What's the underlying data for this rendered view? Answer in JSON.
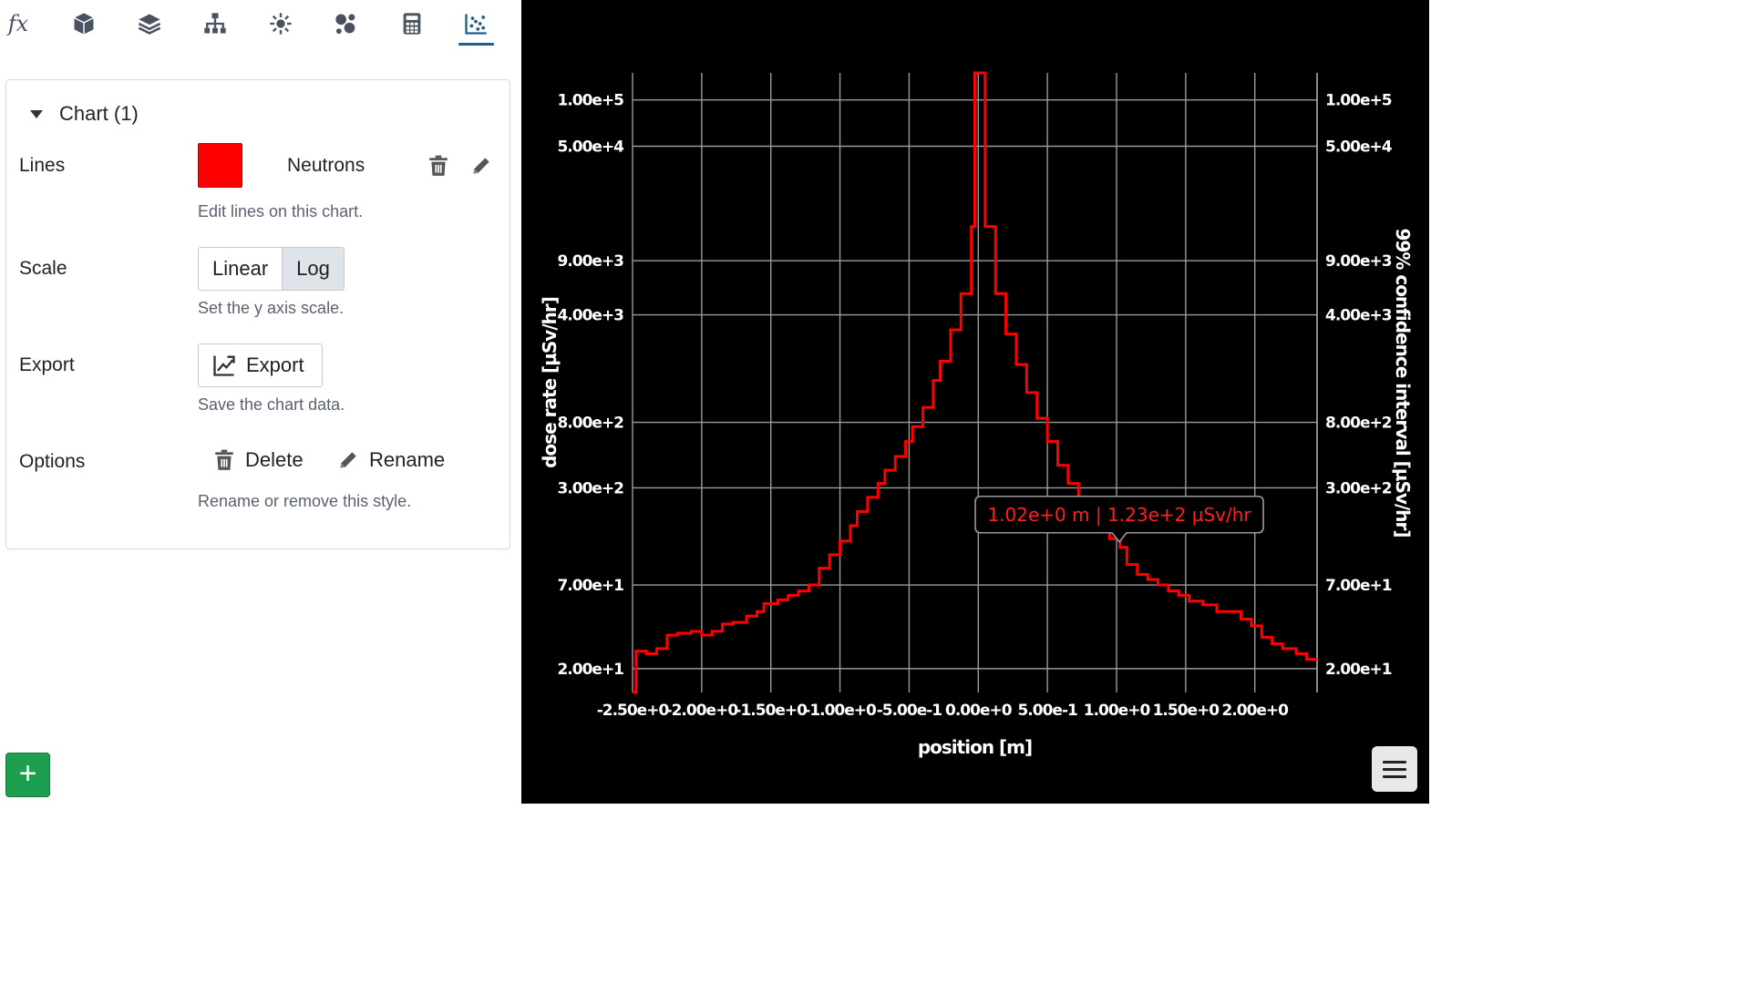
{
  "toolbar": {
    "items": [
      {
        "icon": "function-icon",
        "glyph": "fx"
      },
      {
        "icon": "cube-icon"
      },
      {
        "icon": "layers-icon"
      },
      {
        "icon": "hierarchy-icon"
      },
      {
        "icon": "radiation-source-icon"
      },
      {
        "icon": "molecule-icon"
      },
      {
        "icon": "calculator-icon"
      },
      {
        "icon": "scatter-chart-icon",
        "active": true
      }
    ]
  },
  "panel": {
    "card_title": "Chart (1)",
    "lines": {
      "label": "Lines",
      "swatch_color": "#ff0000",
      "line_name": "Neutrons",
      "help": "Edit lines on this chart."
    },
    "scale": {
      "label": "Scale",
      "options": [
        "Linear",
        "Log"
      ],
      "selected": "Log",
      "help": "Set the y axis scale."
    },
    "export": {
      "label": "Export",
      "button": "Export",
      "help": "Save the chart data."
    },
    "options": {
      "label": "Options",
      "delete": "Delete",
      "rename": "Rename",
      "help": "Rename or remove this style."
    },
    "add_button": "+"
  },
  "chart_data": {
    "type": "line",
    "step": true,
    "xlabel": "position [m]",
    "ylabel": "dose rate [µSv/hr]",
    "y2label": "99% confidence interval [µSv/hr]",
    "xlim": [
      -2.5,
      2.45
    ],
    "ylim": [
      14,
      150000
    ],
    "yscale": "log",
    "grid": true,
    "x_ticks": [
      "-2.50e+0",
      "-2.00e+0",
      "-1.50e+0",
      "-1.00e+0",
      "-5.00e-1",
      "0.00e+0",
      "5.00e-1",
      "1.00e+0",
      "1.50e+0",
      "2.00e+0"
    ],
    "x_tick_values": [
      -2.5,
      -2.0,
      -1.5,
      -1.0,
      -0.5,
      0.0,
      0.5,
      1.0,
      1.5,
      2.0
    ],
    "y_ticks": [
      "1.00e+5",
      "5.00e+4",
      "9.00e+3",
      "4.00e+3",
      "8.00e+2",
      "3.00e+2",
      "7.00e+1",
      "2.00e+1"
    ],
    "y_tick_values": [
      100000,
      50000,
      9000,
      4000,
      800,
      300,
      70,
      20
    ],
    "series": [
      {
        "name": "Neutrons",
        "color": "#ff0000",
        "bin_edges": [
          -2.5,
          -2.475,
          -2.4,
          -2.325,
          -2.25,
          -2.175,
          -2.075,
          -2.0,
          -1.925,
          -1.85,
          -1.775,
          -1.675,
          -1.6,
          -1.55,
          -1.45,
          -1.375,
          -1.3,
          -1.225,
          -1.15,
          -1.075,
          -1.0,
          -0.925,
          -0.875,
          -0.8,
          -0.725,
          -0.675,
          -0.6,
          -0.525,
          -0.475,
          -0.4,
          -0.325,
          -0.275,
          -0.2,
          -0.125,
          -0.05,
          -0.025,
          0.025,
          0.05,
          0.125,
          0.2,
          0.275,
          0.35,
          0.425,
          0.5,
          0.575,
          0.65,
          0.725,
          0.8,
          0.875,
          0.95,
          1.025,
          1.075,
          1.15,
          1.225,
          1.3,
          1.375,
          1.45,
          1.525,
          1.625,
          1.725,
          1.825,
          1.9,
          1.975,
          2.05,
          2.125,
          2.2,
          2.3,
          2.375,
          2.45
        ],
        "values": [
          13,
          26,
          25,
          27,
          33,
          34,
          35,
          33,
          35,
          39,
          40,
          44,
          47,
          53,
          56,
          60,
          64,
          70,
          90,
          110,
          135,
          170,
          210,
          260,
          320,
          390,
          480,
          600,
          750,
          1000,
          1500,
          2000,
          3200,
          5500,
          15000,
          1000000,
          1000000,
          15000,
          5500,
          3000,
          1900,
          1250,
          850,
          600,
          420,
          320,
          250,
          200,
          160,
          140,
          123,
          95,
          82,
          76,
          70,
          64,
          60,
          55,
          52,
          47,
          47,
          42,
          38,
          32,
          29,
          27,
          25,
          23
        ]
      }
    ],
    "tooltip": "1.02e+0 m | 1.23e+2 µSv/hr",
    "tooltip_x": 1.02,
    "tooltip_y": 123
  }
}
